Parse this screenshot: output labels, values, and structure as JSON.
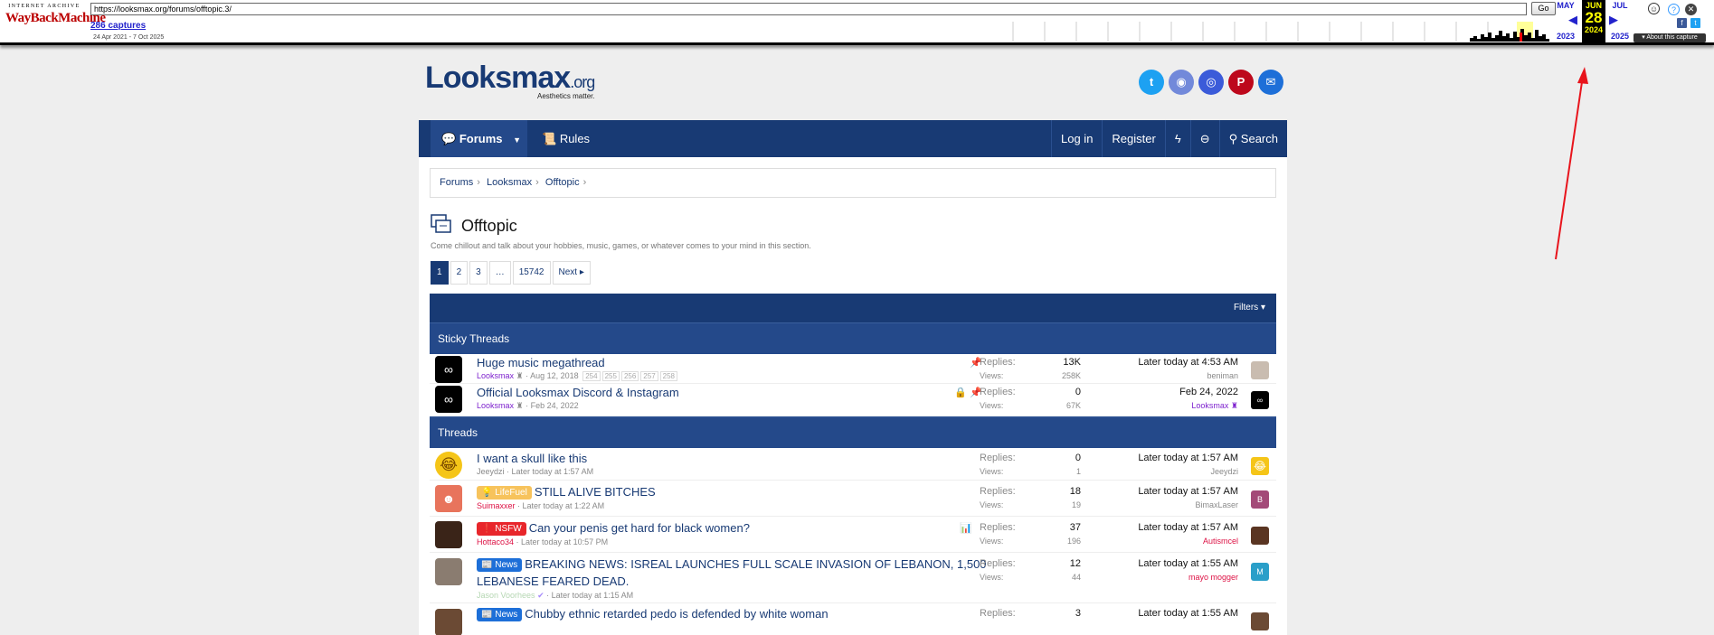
{
  "wayback": {
    "logo_top": "INTERNET ARCHIVE",
    "logo_main": "WayBackMachine",
    "url": "https://looksmax.org/forums/offtopic.3/",
    "go": "Go",
    "captures": "286 captures",
    "range": "24 Apr 2021 - 7 Oct 2025",
    "prev_month": "MAY",
    "cur_month": "JUN",
    "cur_day": "28",
    "cur_year": "2024",
    "next_month": "JUL",
    "prev_year": "2023",
    "next_year": "2025",
    "about": "About this capture"
  },
  "site": {
    "logo_main": "Looksmax",
    "logo_org": ".org",
    "tagline": "Aesthetics matter.",
    "socials": [
      {
        "icon": "twitter-icon",
        "color": "#1da1f2"
      },
      {
        "icon": "discord-icon",
        "color": "#7289da"
      },
      {
        "icon": "instagram-icon",
        "color": "#3b5bd9"
      },
      {
        "icon": "pinterest-icon",
        "color": "#bd081c"
      },
      {
        "icon": "mail-icon",
        "color": "#1d6fd8"
      }
    ]
  },
  "nav": {
    "forums": "Forums",
    "rules": "Rules",
    "login": "Log in",
    "register": "Register",
    "search": "Search"
  },
  "breadcrumb": [
    "Forums",
    "Looksmax",
    "Offtopic"
  ],
  "forum": {
    "title": "Offtopic",
    "description": "Come chillout and talk about your hobbies, music, games, or whatever comes to your mind in this section.",
    "pages": [
      "1",
      "2",
      "3",
      "…",
      "15742"
    ],
    "next": "Next",
    "filters": "Filters",
    "sticky_header": "Sticky Threads",
    "threads_header": "Threads",
    "replies_label": "Replies:",
    "views_label": "Views:"
  },
  "sticky": [
    {
      "title": "Huge music megathread",
      "author": "Looksmax",
      "date": "Aug 12, 2018",
      "pages": [
        "254",
        "255",
        "256",
        "257",
        "258"
      ],
      "replies": "13K",
      "views": "258K",
      "last_date": "Later today at 4:53 AM",
      "last_user": "beniman"
    },
    {
      "title": "Official Looksmax Discord & Instagram",
      "author": "Looksmax",
      "date": "Feb 24, 2022",
      "replies": "0",
      "views": "67K",
      "last_date": "Feb 24, 2022",
      "last_user": "Looksmax"
    }
  ],
  "threads": [
    {
      "title": "I want a skull like this",
      "prefix": "",
      "author": "Jeeydzi",
      "date": "Later today at 1:57 AM",
      "replies": "0",
      "views": "1",
      "last_date": "Later today at 1:57 AM",
      "last_user": "Jeeydzi"
    },
    {
      "title": "STILL ALIVE BITCHES",
      "prefix": "LifeFuel",
      "author": "Suimaxxer",
      "date": "Later today at 1:22 AM",
      "replies": "18",
      "views": "19",
      "last_date": "Later today at 1:57 AM",
      "last_user": "BimaxLaser"
    },
    {
      "title": "Can your penis get hard for black women?",
      "prefix": "NSFW",
      "author": "Hottaco34",
      "date": "Later today at 10:57 PM",
      "replies": "37",
      "views": "196",
      "last_date": "Later today at 1:57 AM",
      "last_user": "Autismcel"
    },
    {
      "title": "BREAKING NEWS: ISREAL LAUNCHES FULL SCALE INVASION OF LEBANON, 1,500",
      "title2": "LEBANESE FEARED DEAD.",
      "prefix": "News",
      "author": "Jason Voorhees",
      "date": "Later today at 1:15 AM",
      "replies": "12",
      "views": "44",
      "last_date": "Later today at 1:55 AM",
      "last_user": "mayo mogger"
    },
    {
      "title": "Chubby ethnic retarded pedo is defended by white woman",
      "prefix": "News",
      "replies": "3",
      "last_date": "Later today at 1:55 AM"
    }
  ]
}
